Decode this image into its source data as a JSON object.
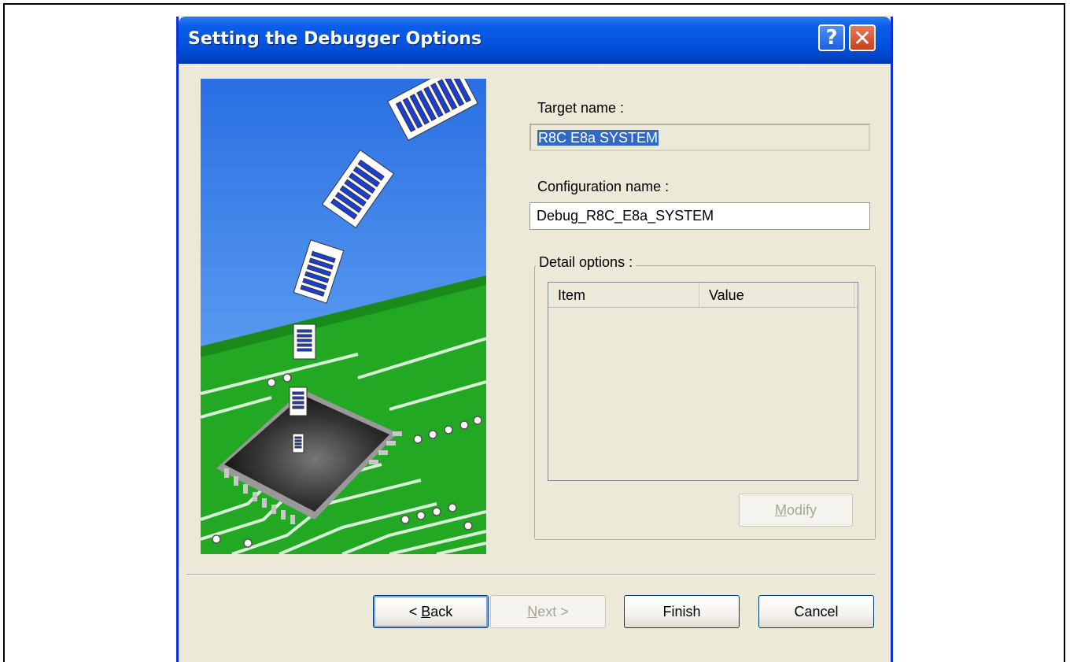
{
  "dialog": {
    "title": "Setting the Debugger Options",
    "help_symbol": "?",
    "close_symbol": "✕"
  },
  "form": {
    "target_label": "Target name :",
    "target_value": "R8C E8a SYSTEM",
    "config_label": "Configuration name :",
    "config_value": "Debug_R8C_E8a_SYSTEM",
    "detail_label": "Detail options :",
    "columns": [
      "Item",
      "Value"
    ],
    "modify_button": {
      "mnemonic": "M",
      "rest": "odify"
    }
  },
  "buttons": {
    "back": {
      "prefix": "< ",
      "mnemonic": "B",
      "rest": "ack"
    },
    "next": {
      "mnemonic": "N",
      "rest": "ext >"
    },
    "finish": "Finish",
    "cancel": "Cancel"
  },
  "colors": {
    "titlebar": "#0554e0",
    "dialog_bg": "#ece9d8",
    "selection": "#316ac5",
    "sky_top": "#2a6fe3",
    "board_green": "#22a822"
  }
}
